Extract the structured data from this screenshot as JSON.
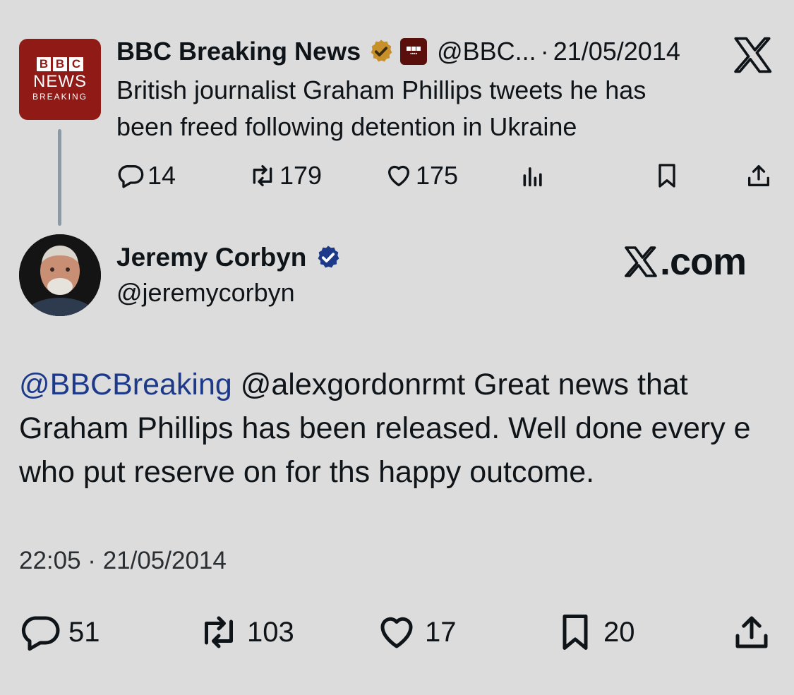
{
  "quoted": {
    "avatar": {
      "blocks": [
        "B",
        "B",
        "C"
      ],
      "line1": "NEWS",
      "line2": "BREAKING"
    },
    "name": "BBC Breaking News",
    "handle": "@BBC...",
    "date_sep": "·",
    "date": "21/05/2014",
    "text_line1": "British journalist Graham Phillips tweets he has",
    "text_line2": "been freed following detention in Ukraine",
    "stats": {
      "replies": "14",
      "reposts": "179",
      "likes": "175"
    }
  },
  "main": {
    "name": "Jeremy Corbyn",
    "handle": "@jeremycorbyn",
    "mention": "@BBCBreaking",
    "line1_rest": " @alexgordonrmt Great news that",
    "line2": "Graham Phillips has been released. Well done every e",
    "line3": "who put reserve on for ths happy outcome.",
    "timestamp": "22:05 · 21/05/2014",
    "stats": {
      "replies": "51",
      "reposts": "103",
      "likes": "17",
      "bookmarks": "20"
    }
  },
  "watermark": {
    "suffix": ".com"
  },
  "icons": {
    "gold_badge": "gold-verified-icon",
    "blue_badge": "blue-verified-icon",
    "x_logo": "x-logo-icon",
    "reply": "reply-icon",
    "repost": "repost-icon",
    "like": "heart-icon",
    "views": "views-icon",
    "bookmark": "bookmark-icon",
    "share": "share-icon"
  },
  "colors": {
    "background": "#dcdcdc",
    "bbc_red": "#8f1a16",
    "gold_badge": "#c8902a",
    "blue_badge": "#1d3a8a",
    "mention": "#1d3a8a",
    "thread_line": "#8d9aa3"
  }
}
